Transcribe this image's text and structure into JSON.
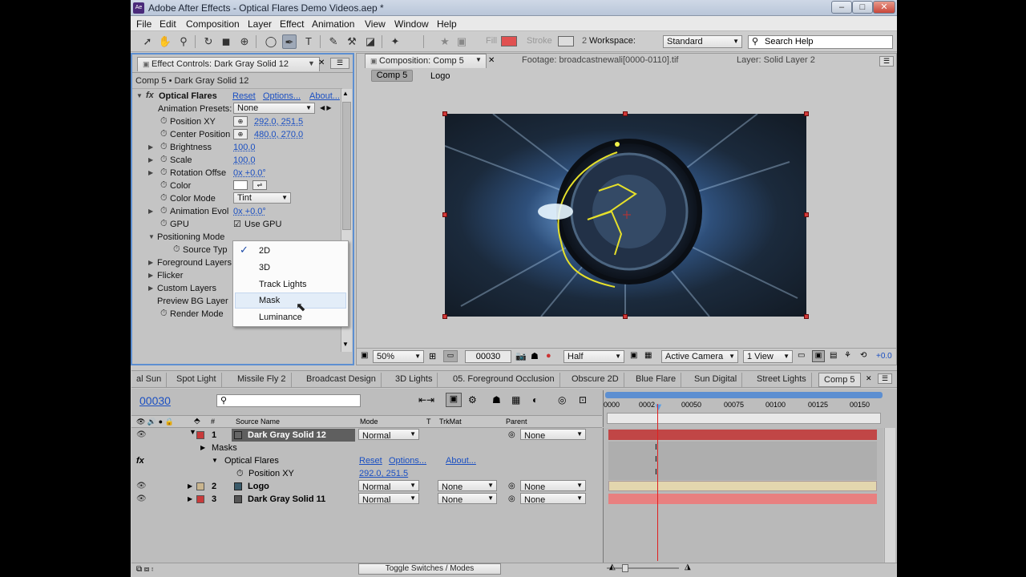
{
  "window": {
    "title": "Adobe After Effects - Optical Flares Demo Videos.aep *",
    "app_icon": "Ae"
  },
  "menu": [
    "File",
    "Edit",
    "Composition",
    "Layer",
    "Effect",
    "Animation",
    "View",
    "Window",
    "Help"
  ],
  "toolbar": {
    "fill_label": "Fill",
    "stroke_label": "Stroke",
    "workspace_num": "2",
    "workspace_label": "Workspace:",
    "workspace_value": "Standard",
    "search_help": "Search Help",
    "fill_color": "#e05050"
  },
  "effect_controls": {
    "tab": "Effect Controls: Dark Gray Solid 12",
    "header": "Comp 5 • Dark Gray Solid 12",
    "effect_name": "Optical Flares",
    "reset": "Reset",
    "options": "Options...",
    "about": "About...",
    "rows": {
      "presets_label": "Animation Presets:",
      "presets_value": "None",
      "posxy_label": "Position XY",
      "posxy_value": "292.0, 251.5",
      "center_label": "Center Position",
      "center_value": "480.0, 270.0",
      "brightness_label": "Brightness",
      "brightness_value": "100.0",
      "scale_label": "Scale",
      "scale_value": "100.0",
      "rotation_label": "Rotation Offse",
      "rotation_value": "0x +0.0°",
      "color_label": "Color",
      "colormode_label": "Color Mode",
      "colormode_value": "Tint",
      "animevol_label": "Animation Evol",
      "animevol_value": "0x +0.0°",
      "gpu_label": "GPU",
      "gpu_value": "Use GPU",
      "posmode_label": "Positioning Mode",
      "sourcetype_label": "Source Typ",
      "fgl_label": "Foreground Layers",
      "flicker_label": "Flicker",
      "custom_label": "Custom Layers",
      "previewbg_label": "Preview BG Layer",
      "render_label": "Render Mode"
    },
    "popup": {
      "items": [
        "2D",
        "3D",
        "Track Lights",
        "Mask",
        "Luminance"
      ],
      "checked": "✓"
    }
  },
  "comp_panel": {
    "tab_comp": "Composition: Comp 5",
    "tab_footage": "Footage: broadcastnewali[0000-0110].tif",
    "tab_layer": "Layer: Solid Layer 2",
    "crumb_comp": "Comp 5",
    "crumb_logo": "Logo",
    "zoom": "50%",
    "timecode": "00030",
    "resolution": "Half",
    "camera": "Active Camera",
    "views": "1 View",
    "exposure": "+0.0"
  },
  "timeline": {
    "tabs": [
      "al Sun",
      "Spot Light",
      "Missile Fly 2",
      "Broadcast Design",
      "3D Lights",
      "05. Foreground Occlusion",
      "Obscure 2D",
      "Blue Flare",
      "Sun Digital",
      "Street Lights",
      "Comp 5"
    ],
    "current_time": "00030",
    "columns": {
      "source": "Source Name",
      "mode": "Mode",
      "t": "T",
      "trkmat": "TrkMat",
      "parent": "Parent",
      "hash": "#"
    },
    "ruler": [
      "0000",
      "0002",
      "00050",
      "00075",
      "00100",
      "00125",
      "00150"
    ],
    "layers": [
      {
        "num": "1",
        "name": "Dark Gray Solid 12",
        "mode": "Normal",
        "trkmat": "",
        "parent": "None",
        "color": "#c83a3a"
      },
      {
        "num": "2",
        "name": "Logo",
        "mode": "Normal",
        "trkmat": "None",
        "parent": "None",
        "color": "#c9b58e"
      },
      {
        "num": "3",
        "name": "Dark Gray Solid 11",
        "mode": "Normal",
        "trkmat": "None",
        "parent": "None",
        "color": "#c83a3a"
      }
    ],
    "sub_masks": "Masks",
    "sub_effect": "Optical Flares",
    "sub_reset": "Reset",
    "sub_options": "Options...",
    "sub_about": "About...",
    "sub_posxy": "Position XY",
    "sub_posxy_value": "292.0, 251.5",
    "toggle": "Toggle Switches / Modes"
  }
}
